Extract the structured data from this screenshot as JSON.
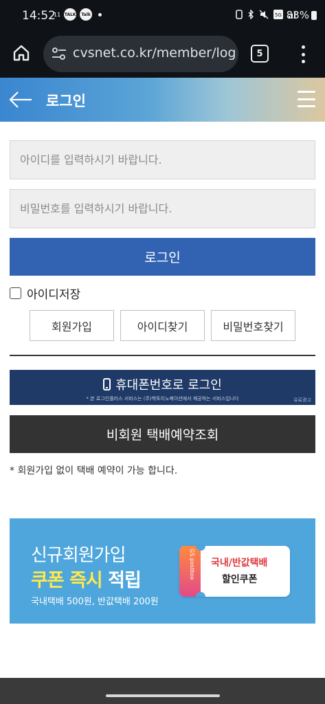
{
  "status_bar": {
    "time": "14:52",
    "notif_badges": [
      "11",
      "TALK",
      "Talk"
    ],
    "battery": "83%"
  },
  "browser": {
    "url": "cvsnet.co.kr/member/log",
    "tab_count": "5"
  },
  "header": {
    "title": "로그인"
  },
  "form": {
    "id_placeholder": "아이디를 입력하시기 바랍니다.",
    "pw_placeholder": "비밀번호를 입력하시기 바랍니다.",
    "login_label": "로그인",
    "save_id_label": "아이디저장",
    "save_id_checked": false,
    "buttons": {
      "signup": "회원가입",
      "find_id": "아이디찾기",
      "find_pw": "비밀번호찾기"
    }
  },
  "phone_login": {
    "label": "휴대폰번호로 로그인",
    "note": "* 본 로그인플러스 서비스는 (주)핵토이노베이션에서 제공하는 서비스입니다",
    "ad_label": "유료광고"
  },
  "guest": {
    "button_label": "비회원 택배예약조회",
    "note": "* 회원가입 없이 택배 예약이 가능 합니다."
  },
  "banner": {
    "line1": "신규회원가입",
    "line2_highlight": "쿠폰 즉시",
    "line2_rest": "적립",
    "line3": "국내택배 500원, 반값택배 200원",
    "ticket_brand": "GS postbox",
    "ticket_line1": "국내/반값택배",
    "ticket_line2": "할인쿠폰"
  },
  "colors": {
    "login_button": "#3263b3",
    "phone_login": "#1f3a66",
    "guest_button": "#333333",
    "banner_bg": "#4ea6dc",
    "highlight": "#ffe94a"
  }
}
